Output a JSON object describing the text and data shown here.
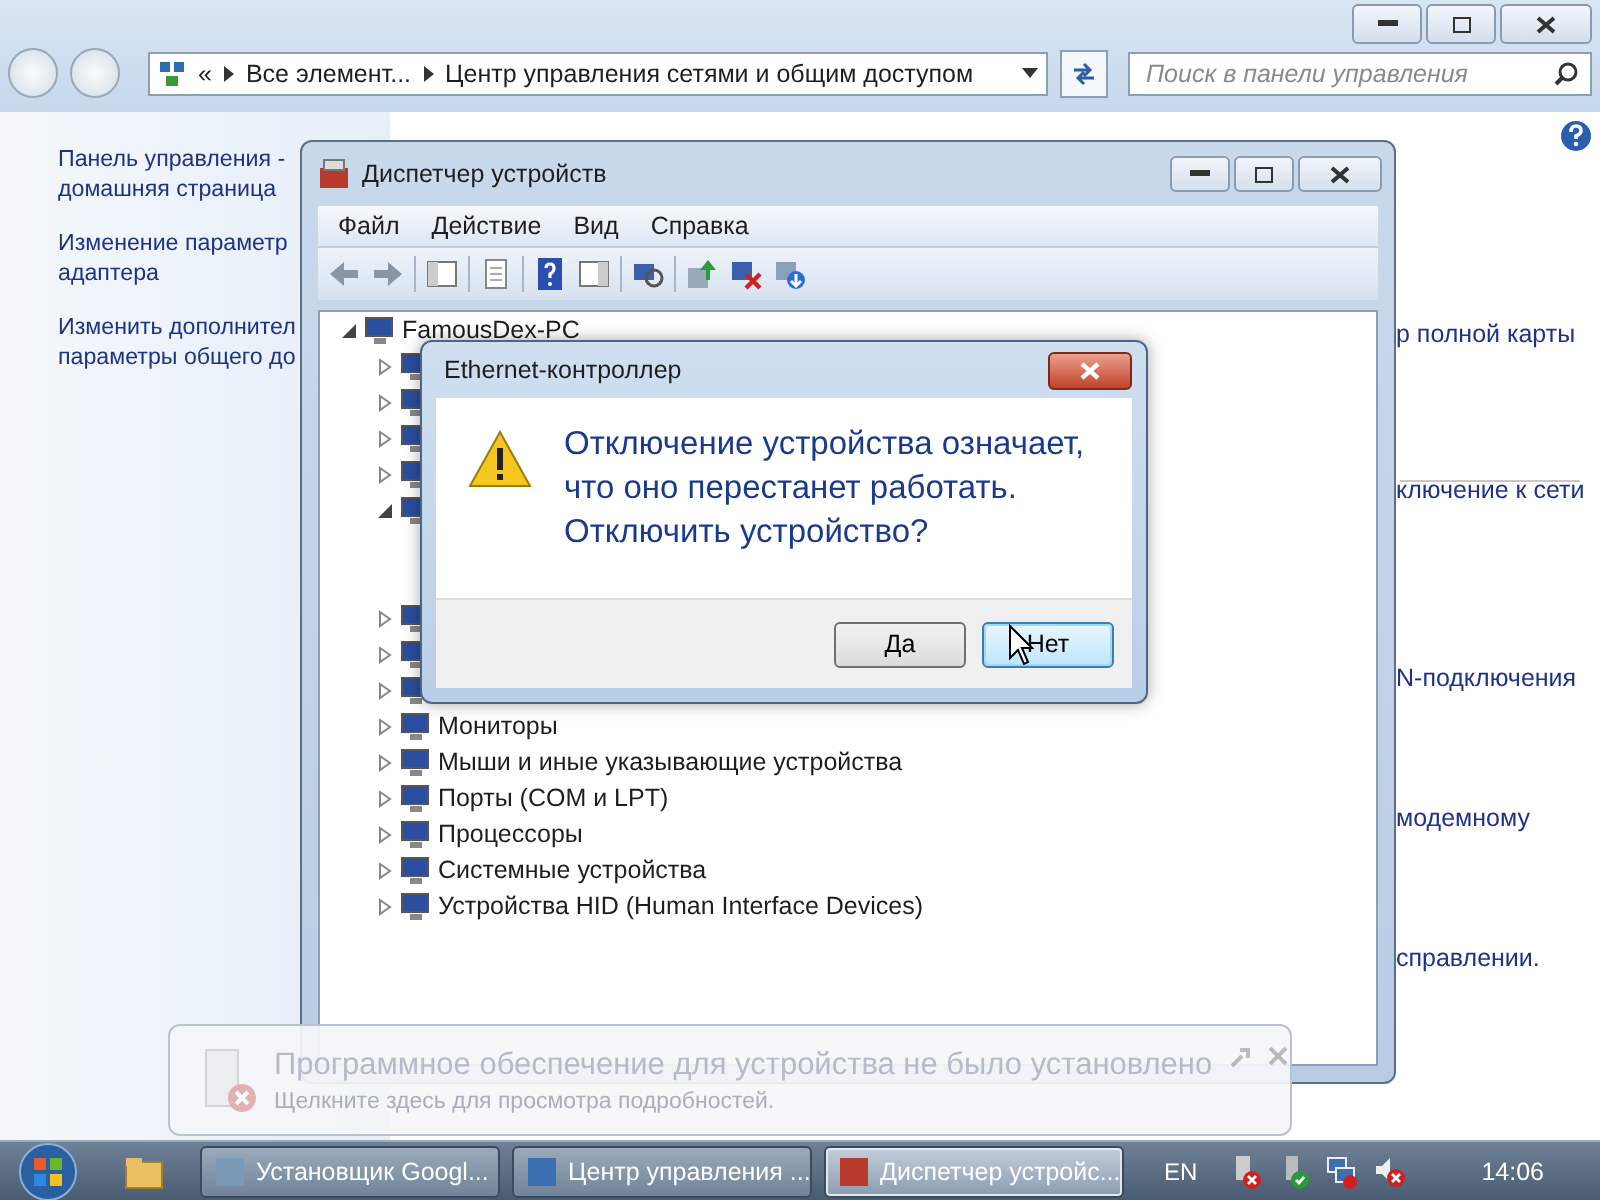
{
  "control_panel": {
    "address": {
      "overflow": "«",
      "crumbs": [
        "Все элемент...",
        "Центр управления сетями и общим доступом"
      ]
    },
    "search": {
      "placeholder": "Поиск в панели управления"
    },
    "nav_links": [
      "Панель управления -\nдомашняя страница",
      "Изменение параметр\nадаптера",
      "Изменить дополнител\nпараметры общего до"
    ],
    "content_fragments": [
      "р полной карты",
      "ключение к сети",
      "N-подключения",
      "модемному",
      "справлении."
    ]
  },
  "device_manager": {
    "title": "Диспетчер устройств",
    "menu": [
      "Файл",
      "Действие",
      "Вид",
      "Справка"
    ],
    "tree": {
      "label": "FamousDex-PC",
      "expanded": true,
      "children": [
        {
          "expanded": false
        },
        {
          "expanded": false
        },
        {
          "expanded": false
        },
        {
          "expanded": false
        },
        {
          "expanded": true
        },
        {
          "expanded": false
        },
        {
          "expanded": false
        },
        {
          "expanded": false
        },
        {
          "label": "Мониторы",
          "expanded": false
        },
        {
          "label": "Мыши и иные указывающие устройства",
          "expanded": false
        },
        {
          "label": "Порты (COM и LPT)",
          "expanded": false
        },
        {
          "label": "Процессоры",
          "expanded": false
        },
        {
          "label": "Системные устройства",
          "expanded": false
        },
        {
          "label": "Устройства HID (Human Interface Devices)",
          "expanded": false
        }
      ]
    }
  },
  "dialog": {
    "title": "Ethernet-контроллер",
    "message": "Отключение устройства означает, что оно перестанет работать. Отключить устройство?",
    "buttons": [
      {
        "label": "Да",
        "default": false
      },
      {
        "label": "Нет",
        "default": true
      }
    ]
  },
  "notification": {
    "title": "Программное обеспечение для устройства не было установлено",
    "subtitle": "Щелкните здесь для просмотра подробностей."
  },
  "taskbar": {
    "tasks": [
      {
        "label": "Установщик Googl...",
        "selected": false
      },
      {
        "label": "Центр управления ...",
        "selected": false
      },
      {
        "label": "Диспетчер устройс...",
        "selected": true
      }
    ],
    "language": "EN",
    "clock": "14:06"
  }
}
